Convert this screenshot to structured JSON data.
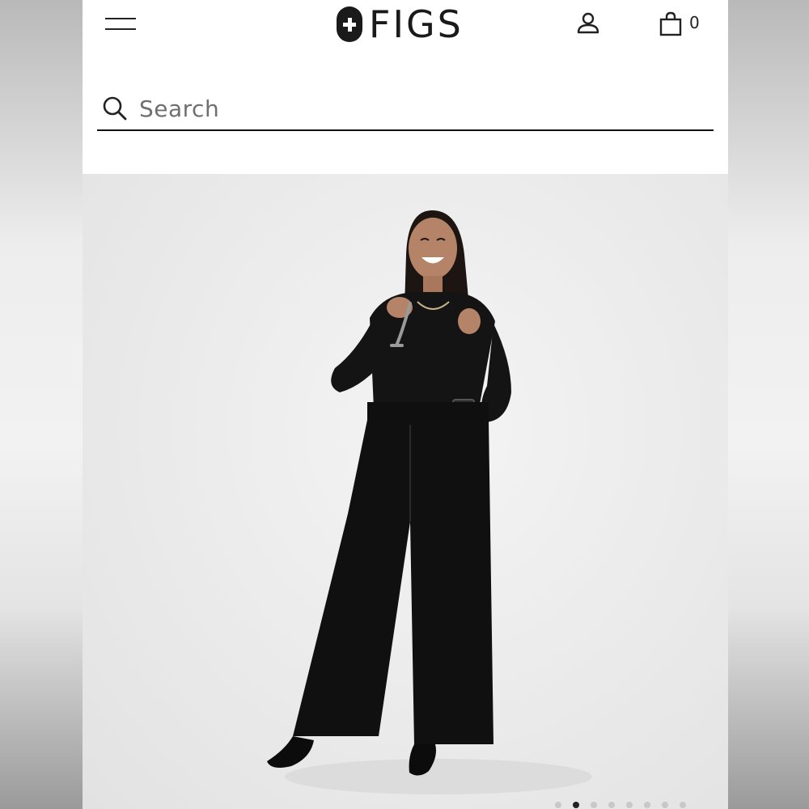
{
  "header": {
    "brand": "FIGS",
    "bag_count": "0"
  },
  "search": {
    "placeholder": "Search"
  },
  "carousel": {
    "slide_count": 8,
    "active_index": 1
  },
  "icons": {
    "menu": "hamburger-menu-icon",
    "logo": "figs-cross-logo-icon",
    "account": "person-icon",
    "bag": "shopping-bag-icon",
    "search": "magnifier-icon"
  },
  "colors": {
    "brand_dark": "#1a1a1a",
    "page_bg": "#ffffff",
    "hero_bg": "#ececec",
    "placeholder": "#6f6f6f"
  }
}
